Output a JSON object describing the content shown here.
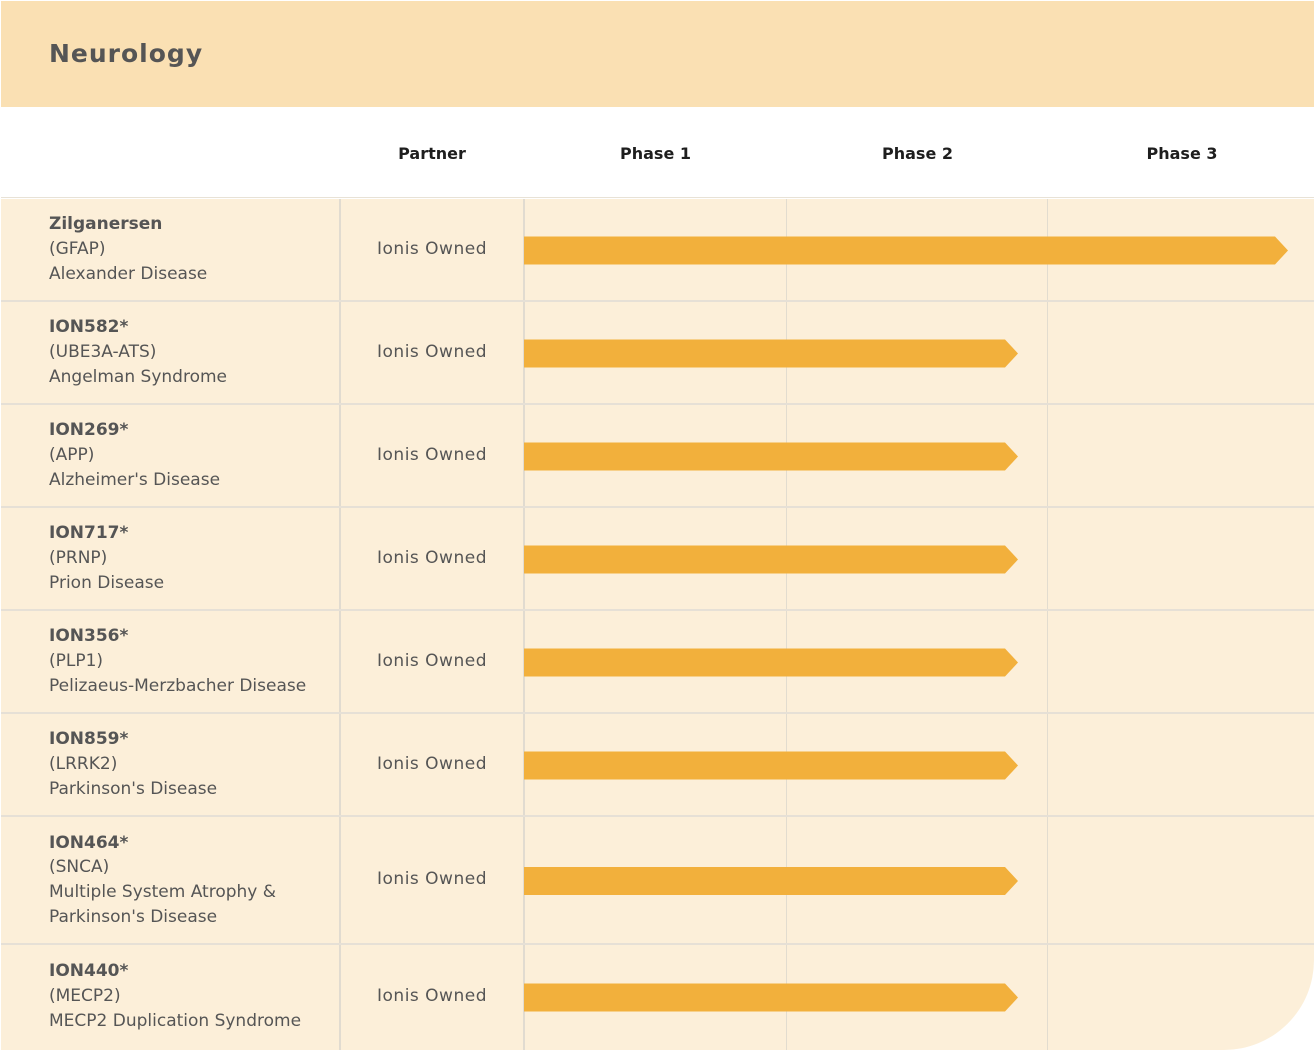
{
  "title": "Neurology",
  "columns": {
    "partner": "Partner",
    "phase1": "Phase 1",
    "phase2": "Phase 2",
    "phase3": "Phase 3"
  },
  "colors": {
    "header_band": "#fae0b3",
    "body_background": "#fcefd9",
    "bar": "#f2b03c"
  },
  "chart_data": {
    "type": "table",
    "phases": [
      "Phase 1",
      "Phase 2",
      "Phase 3"
    ],
    "rows": [
      {
        "drug": "Zilganersen",
        "target": "(GFAP)",
        "indication": [
          "Alexander Disease"
        ],
        "partner": "Ionis Owned",
        "phase_progress": 3
      },
      {
        "drug": "ION582*",
        "target": "(UBE3A-ATS)",
        "indication": [
          "Angelman Syndrome"
        ],
        "partner": "Ionis Owned",
        "phase_progress": 2
      },
      {
        "drug": "ION269*",
        "target": "(APP)",
        "indication": [
          "Alzheimer's Disease"
        ],
        "partner": "Ionis Owned",
        "phase_progress": 2
      },
      {
        "drug": "ION717*",
        "target": "(PRNP)",
        "indication": [
          "Prion Disease"
        ],
        "partner": "Ionis Owned",
        "phase_progress": 2
      },
      {
        "drug": "ION356*",
        "target": "(PLP1)",
        "indication": [
          "Pelizaeus-Merzbacher Disease"
        ],
        "partner": "Ionis Owned",
        "phase_progress": 2
      },
      {
        "drug": "ION859*",
        "target": "(LRRK2)",
        "indication": [
          "Parkinson's Disease"
        ],
        "partner": "Ionis Owned",
        "phase_progress": 2
      },
      {
        "drug": "ION464*",
        "target": "(SNCA)",
        "indication": [
          "Multiple System Atrophy &",
          "Parkinson's Disease"
        ],
        "partner": "Ionis Owned",
        "phase_progress": 2
      },
      {
        "drug": "ION440*",
        "target": "(MECP2)",
        "indication": [
          "MECP2 Duplication Syndrome"
        ],
        "partner": "Ionis Owned",
        "phase_progress": 2
      }
    ]
  }
}
